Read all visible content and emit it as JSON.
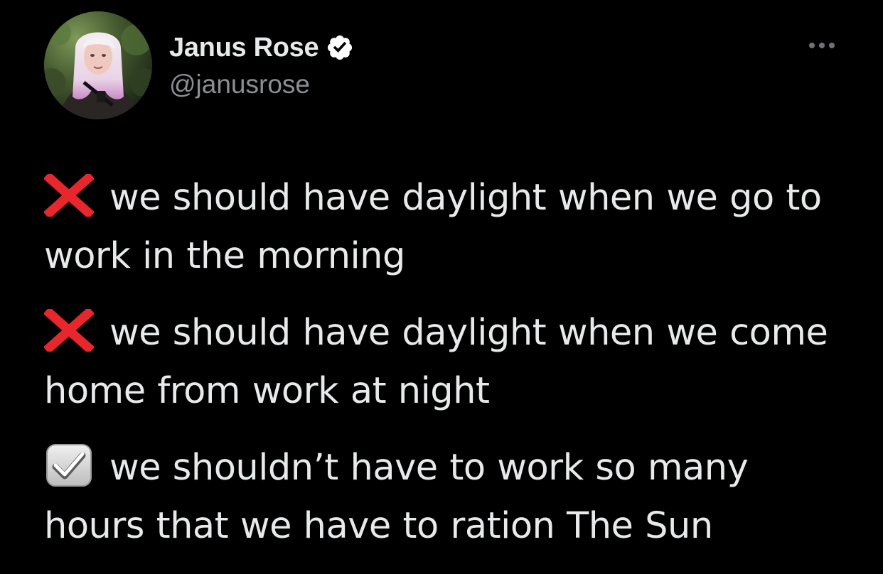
{
  "author": {
    "display_name": "Janus Rose",
    "handle": "@janusrose",
    "verified": true,
    "verified_color": "#ffffff"
  },
  "more_menu": {
    "icon": "more-horizontal-icon"
  },
  "tweet": {
    "items": [
      {
        "marker": "cross-mark-emoji",
        "marker_color": "#e8262b",
        "text": "we should have daylight when we go to work in the morning"
      },
      {
        "marker": "cross-mark-emoji",
        "marker_color": "#e8262b",
        "text": "we should have daylight when we come home from work at night"
      },
      {
        "marker": "check-box-emoji",
        "marker_color": "#d9d9d9",
        "text": "we shouldn’t have to work so many hours that we have to ration The Sun"
      }
    ]
  },
  "colors": {
    "background": "#000000",
    "primary_text": "#e7e9ea",
    "secondary_text": "#8b8f94"
  }
}
